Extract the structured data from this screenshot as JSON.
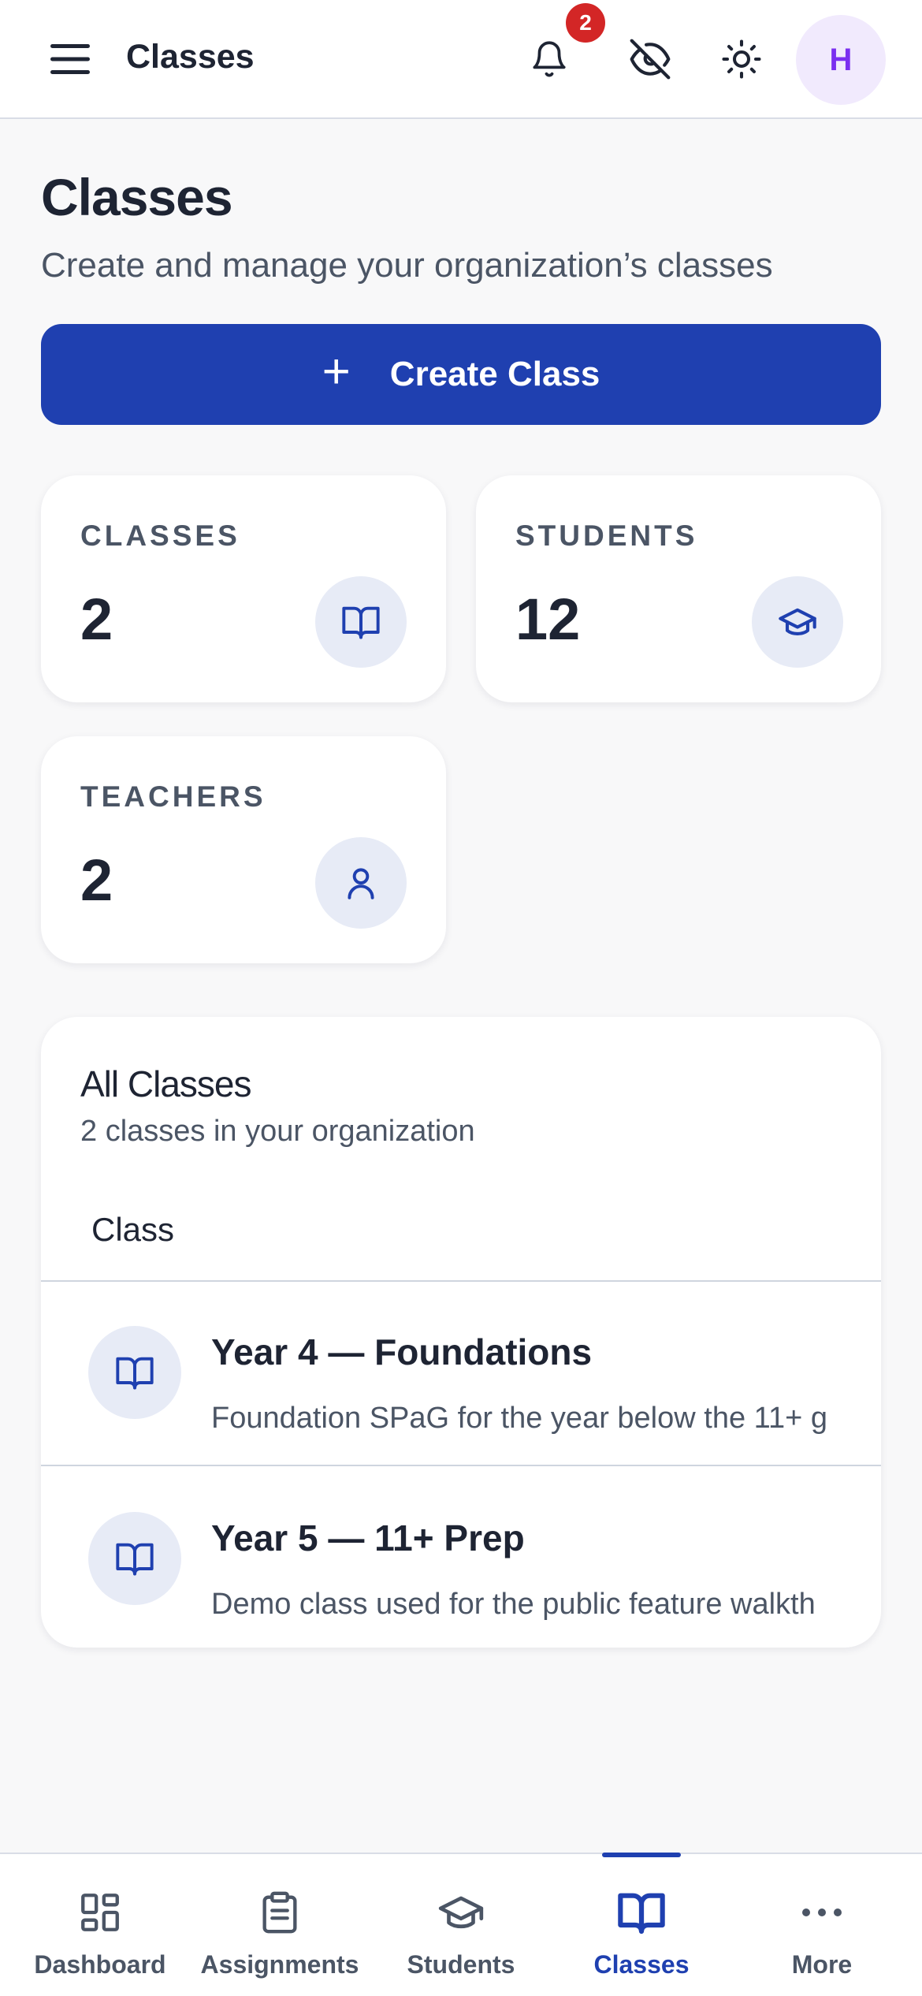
{
  "topbar": {
    "title": "Classes",
    "notification_count": "2",
    "avatar_initial": "H"
  },
  "header": {
    "title": "Classes",
    "subtitle": "Create and manage your organization’s classes"
  },
  "create_button": {
    "icon": "+",
    "label": "Create Class"
  },
  "stats": [
    {
      "label": "CLASSES",
      "value": "2",
      "icon": "book-icon"
    },
    {
      "label": "STUDENTS",
      "value": "12",
      "icon": "graduation-cap-icon"
    },
    {
      "label": "TEACHERS",
      "value": "2",
      "icon": "user-icon"
    }
  ],
  "all_classes": {
    "title": "All Classes",
    "subtitle": "2 classes in your organization",
    "column_header": "Class",
    "rows": [
      {
        "name": "Year 4 — Foundations",
        "description": "Foundation SPaG for the year below the 11+ g"
      },
      {
        "name": "Year 5 — 11+ Prep",
        "description": "Demo class used for the public feature walkth"
      }
    ]
  },
  "bottom_nav": {
    "items": [
      {
        "label": "Dashboard",
        "icon": "dashboard-icon"
      },
      {
        "label": "Assignments",
        "icon": "clipboard-icon"
      },
      {
        "label": "Students",
        "icon": "graduation-cap-icon"
      },
      {
        "label": "Classes",
        "icon": "book-icon",
        "active": true
      },
      {
        "label": "More",
        "icon": "more-icon"
      }
    ]
  },
  "colors": {
    "primary": "#1f40b0",
    "badge": "#d32626",
    "avatar_bg": "#f1eafd",
    "avatar_text": "#7a2ff0",
    "background": "#f8f8f9"
  }
}
